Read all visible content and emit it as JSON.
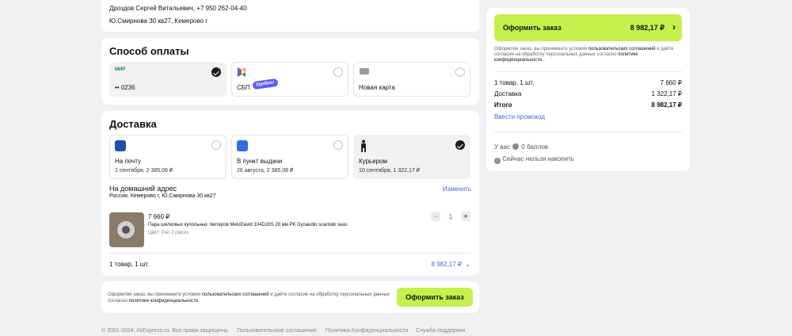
{
  "recipient": {
    "name_phone": "Дроздов Сергей Витальевич, +7 950 262-04-40",
    "address": "Ю.Смирнова 30 кв27, Кемерово г"
  },
  "payment": {
    "title": "Способ оплаты",
    "options": [
      {
        "label": "•• 0236",
        "logo": "МИР",
        "selected": true
      },
      {
        "label": "СБП",
        "badge": "Удобно!",
        "selected": false
      },
      {
        "label": "Новая карта",
        "selected": false
      }
    ]
  },
  "delivery": {
    "title": "Доставка",
    "options": [
      {
        "label": "На почту",
        "detail": "1 сентября, 2 385,08 ₽",
        "selected": false
      },
      {
        "label": "В пункт выдачи",
        "detail": "26 августа, 2 385,08 ₽",
        "selected": false
      },
      {
        "label": "Курьером",
        "detail": "10 сентября, 1 322,17 ₽",
        "selected": true
      }
    ],
    "home_title": "На домашний адрес",
    "home_address": "Россия, Кемерово г, Ю.Смирнова 30 кв27",
    "change_link": "Изменить",
    "product": {
      "price": "7 660 ₽",
      "name": "Пара шелковых купольных твитеров MeloDavid 104D28S 28 мм PK Dynaudio scantalk seas",
      "color": "Цвет: Pair 2 pieces",
      "qty": "1",
      "minus": "−",
      "plus": "+"
    },
    "summary_left": "1 товар, 1 шт.",
    "summary_right": "8 982,17 ₽"
  },
  "confirm_bottom": {
    "text_pre": "Оформляя заказ, вы принимаете условия ",
    "link1": "пользовательских соглашений",
    "text_mid": " и даёте согласие на обработку персональных данных согласно ",
    "link2": "политике конфиденциальности",
    "text_end": ".",
    "button": "Оформить заказ"
  },
  "order_panel": {
    "button_label": "Оформить заказ",
    "button_total": "8 982,17 ₽",
    "legal_pre": "Оформляя заказ, вы принимаете условия ",
    "legal_link1": "пользовательских соглашений",
    "legal_mid": " и даёте согласие на обработку персональных данных согласно ",
    "legal_link2": "политике конфиденциальности",
    "legal_end": ".",
    "items_label": "1 товар, 1 шт.",
    "items_value": "7 660 ₽",
    "delivery_label": "Доставка",
    "delivery_value": "1 322,17 ₽",
    "total_label": "Итого",
    "total_value": "8 982,17 ₽",
    "promo": "Ввести промокод",
    "points_pre": "У вас",
    "points_value": "0 баллов",
    "points_note": "Сейчас нельзя накопить"
  },
  "footer": {
    "copyright": "© 2001-2024, AliExpress.ru. Все права защищены",
    "link1": "Пользовательские соглашения",
    "link2": "Политика Конфиденциальности",
    "link3": "Служба поддержки"
  },
  "colors": {
    "accent_green": "#c6f04c",
    "link_blue": "#3d6be0",
    "sbp_badge": "#5b5cf0"
  }
}
